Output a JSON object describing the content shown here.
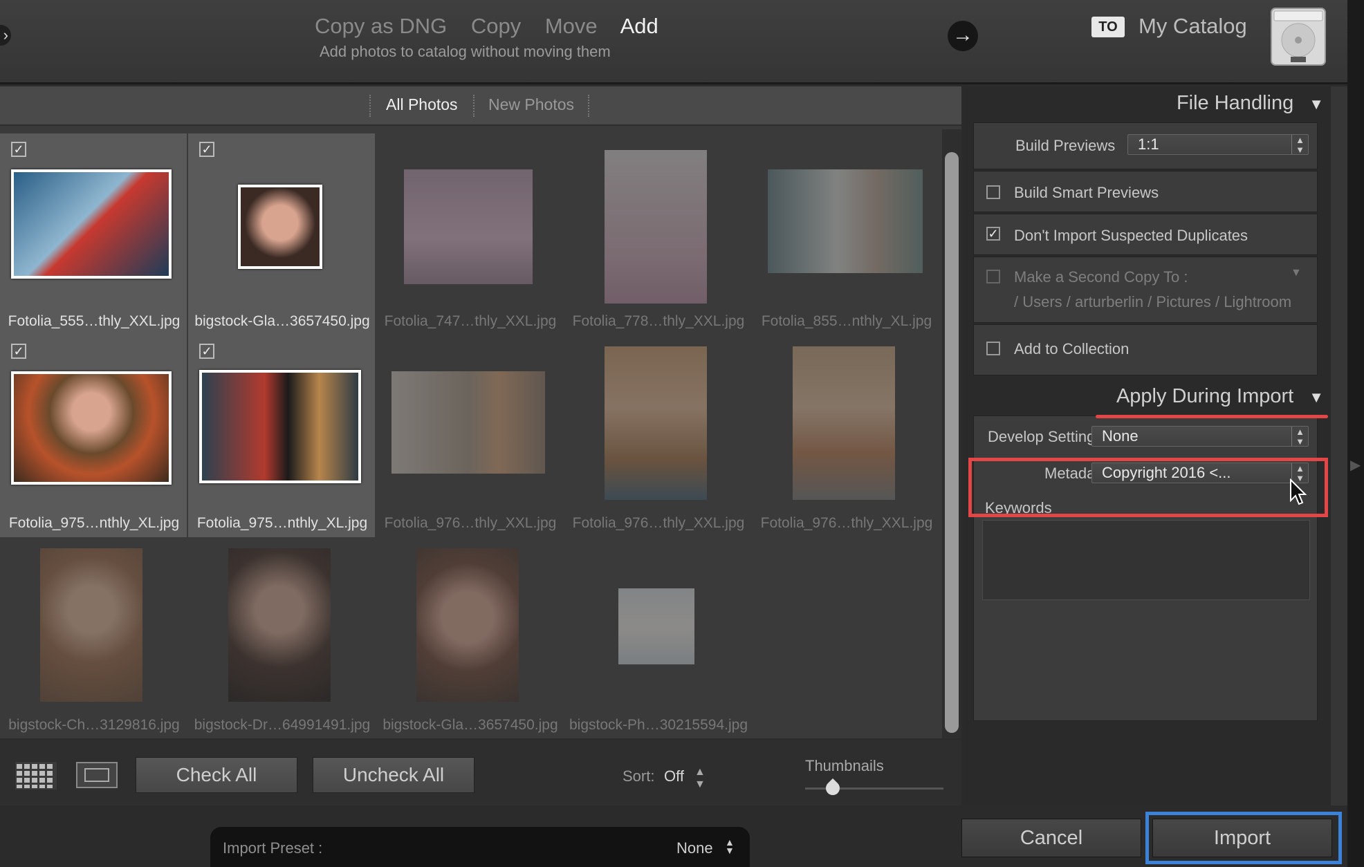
{
  "header": {
    "modes": [
      "Copy as DNG",
      "Copy",
      "Move",
      "Add"
    ],
    "active_mode": "Add",
    "mode_description": "Add photos to catalog without moving them",
    "to_label": "TO",
    "catalog_name": "My Catalog",
    "icons": {
      "back": "chevron-left-icon",
      "go": "arrow-right-icon",
      "drive": "hard-drive-icon"
    }
  },
  "filter": {
    "all_photos": "All Photos",
    "new_photos": "New Photos"
  },
  "photos": [
    {
      "name": "Fotolia_555…thly_XXL.jpg",
      "checked": true
    },
    {
      "name": "bigstock-Gla…3657450.jpg",
      "checked": true
    },
    {
      "name": "Fotolia_747…thly_XXL.jpg",
      "checked": false
    },
    {
      "name": "Fotolia_778…thly_XXL.jpg",
      "checked": false
    },
    {
      "name": "Fotolia_855…nthly_XL.jpg",
      "checked": false
    },
    {
      "name": "Fotolia_975…nthly_XL.jpg",
      "checked": true
    },
    {
      "name": "Fotolia_975…nthly_XL.jpg",
      "checked": true
    },
    {
      "name": "Fotolia_976…thly_XXL.jpg",
      "checked": false
    },
    {
      "name": "Fotolia_976…thly_XXL.jpg",
      "checked": false
    },
    {
      "name": "Fotolia_976…thly_XXL.jpg",
      "checked": false
    },
    {
      "name": "bigstock-Ch…3129816.jpg",
      "checked": false
    },
    {
      "name": "bigstock-Dr…64991491.jpg",
      "checked": false
    },
    {
      "name": "bigstock-Gla…3657450.jpg",
      "checked": false
    },
    {
      "name": "bigstock-Ph…30215594.jpg",
      "checked": false
    }
  ],
  "toolbar": {
    "check_all": "Check All",
    "uncheck_all": "Uncheck All",
    "sort_label": "Sort:",
    "sort_value": "Off",
    "thumbnails_label": "Thumbnails",
    "thumbnail_size": 0.2
  },
  "file_handling": {
    "title": "File Handling",
    "build_previews_label": "Build Previews",
    "build_previews_value": "1:1",
    "build_smart_previews": {
      "label": "Build Smart Previews",
      "checked": false
    },
    "dont_import_duplicates": {
      "label": "Don't Import Suspected Duplicates",
      "checked": true
    },
    "second_copy": {
      "label": "Make a Second Copy To :",
      "path": "/ Users / arturberlin / Pictures / Lightroom",
      "checked": false
    },
    "add_to_collection": {
      "label": "Add to Collection",
      "checked": false
    }
  },
  "apply_during_import": {
    "title": "Apply During Import",
    "develop_settings_label": "Develop Settings",
    "develop_settings_value": "None",
    "metadata_label": "Metadata",
    "metadata_value": "Copyright 2016 <...",
    "keywords_label": "Keywords",
    "keywords_value": ""
  },
  "footer": {
    "import_preset_label": "Import Preset :",
    "import_preset_value": "None",
    "cancel": "Cancel",
    "import": "Import"
  },
  "colors": {
    "highlight_red": "#e34646",
    "highlight_blue": "#3b82d8"
  }
}
